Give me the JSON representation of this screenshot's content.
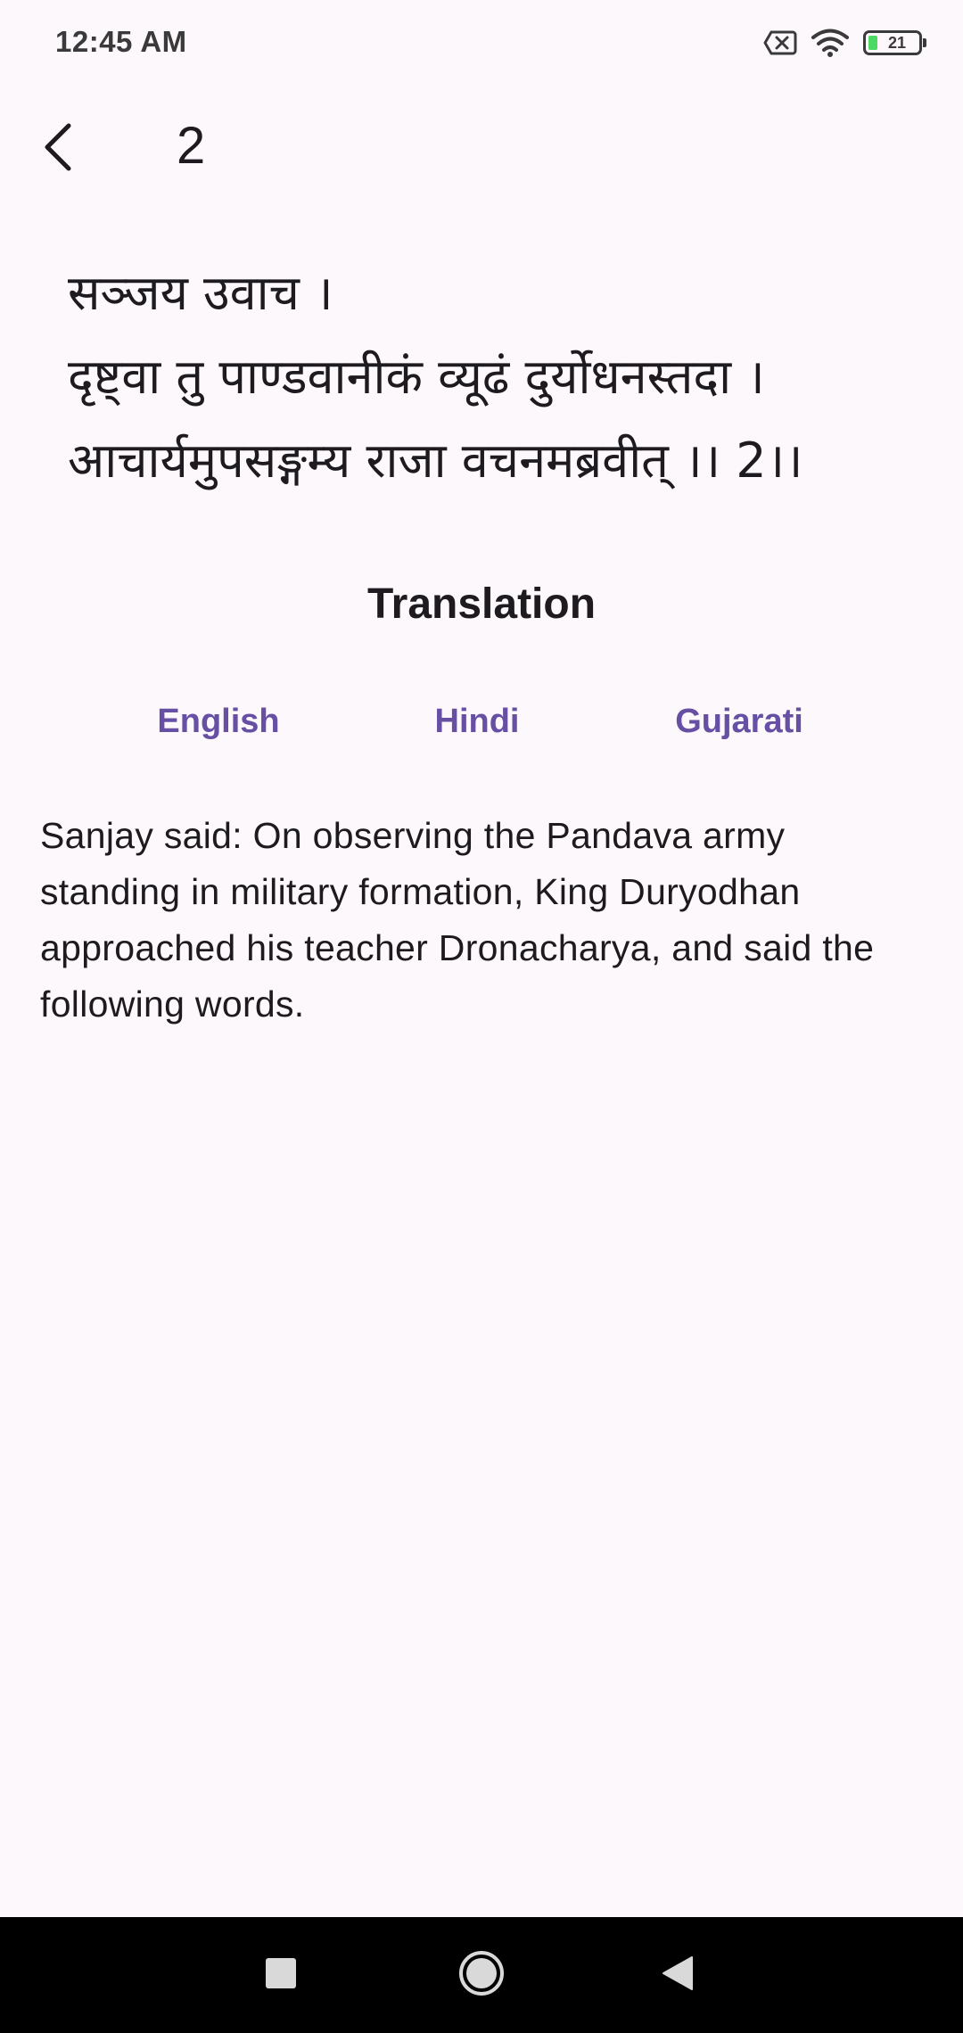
{
  "status_bar": {
    "time": "12:45 AM",
    "battery_level": "21",
    "icons": [
      "sim-x-icon",
      "wifi-icon",
      "battery-icon"
    ]
  },
  "app_bar": {
    "back_icon": "chevron-left-icon",
    "title": "2"
  },
  "verse": {
    "lines": [
      "सञ्जय उवाच ।",
      "दृष्ट्वा तु पाण्डवानीकं व्यूढं दुर्योधनस्तदा ।",
      "आचार्यमुपसङ्गम्य राजा वचनमब्रवीत् ।। 2।।"
    ]
  },
  "translation": {
    "heading": "Translation",
    "tabs": [
      {
        "label": "English"
      },
      {
        "label": "Hindi"
      },
      {
        "label": "Gujarati"
      }
    ],
    "text": "Sanjay said: On observing the Pandava army standing in military formation, King Duryodhan approached his teacher Dronacharya, and said the following words."
  },
  "nav_bar": {
    "icons": [
      "recents-square-icon",
      "home-circle-icon",
      "back-triangle-icon"
    ]
  },
  "colors": {
    "background": "#fdf8fb",
    "accent": "#6750a4",
    "text": "#1d1b20",
    "nav_bar": "#000000"
  }
}
